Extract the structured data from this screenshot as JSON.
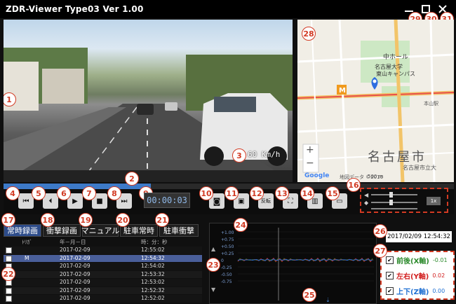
{
  "window": {
    "title": "ZDR-Viewer Type03 Ver 1.00",
    "controls": [
      {
        "badge": "29",
        "icon": "minimize-icon"
      },
      {
        "badge": "30",
        "icon": "maximize-icon"
      },
      {
        "badge": "31",
        "icon": "close-icon"
      }
    ]
  },
  "video": {
    "badge": "1",
    "speed_badge": "3",
    "speed_text": "60 Km/h"
  },
  "map": {
    "badge": "28",
    "labels": {
      "hall": "中ホール",
      "university": "名古屋大学",
      "campus": "東山キャンパス",
      "city": "名古屋市",
      "station": "本山駅",
      "building": "名古屋市立大",
      "google": "Google",
      "scale": "500 m",
      "credit": "地図データ ©2016"
    },
    "zoom_in": "+",
    "zoom_out": "−"
  },
  "seek": {
    "badge": "2"
  },
  "controls": {
    "buttons": [
      {
        "badge": "4",
        "icon": "skip-back-icon",
        "glyph": "⏮"
      },
      {
        "badge": "5",
        "icon": "step-back-icon",
        "glyph": "⏴"
      },
      {
        "badge": "6",
        "icon": "play-icon",
        "glyph": "▶"
      },
      {
        "badge": "7",
        "icon": "stop-icon",
        "glyph": "■"
      },
      {
        "badge": "8",
        "icon": "skip-forward-icon",
        "glyph": "⏭"
      }
    ],
    "time_badge": "9",
    "time": "00:00:03",
    "tools": [
      {
        "badge": "10",
        "icon": "camera-icon",
        "glyph": "📷"
      },
      {
        "badge": "11",
        "icon": "snapshot-icon",
        "glyph": "▣"
      },
      {
        "badge": "12",
        "icon": "rotate-icon",
        "glyph": "反転"
      },
      {
        "badge": "13",
        "icon": "fullscreen-icon",
        "glyph": "⛶"
      },
      {
        "badge": "14",
        "icon": "delete-icon",
        "glyph": "▥"
      },
      {
        "badge": "15",
        "icon": "folder-icon",
        "glyph": "▭"
      }
    ],
    "volume_badge": "16",
    "speed_button": "1x"
  },
  "tabs": [
    {
      "badge": "17",
      "label": "常時録画"
    },
    {
      "badge": "18",
      "label": "衝撃録画"
    },
    {
      "badge": "19",
      "label": "マニュアル"
    },
    {
      "badge": "20",
      "label": "駐車常時"
    },
    {
      "badge": "21",
      "label": "駐車衝撃"
    }
  ],
  "list": {
    "badge": "22",
    "headers": {
      "protect": "ﾄﾘｶﾞ",
      "date": "年－月－日",
      "time": "時：分：秒"
    },
    "rows": [
      {
        "date": "2017-02-09",
        "time": "12:55:02",
        "mark": "",
        "selected": false
      },
      {
        "date": "2017-02-09",
        "time": "12:54:32",
        "mark": "M",
        "selected": true
      },
      {
        "date": "2017-02-09",
        "time": "12:54:02",
        "mark": "",
        "selected": false
      },
      {
        "date": "2017-02-09",
        "time": "12:53:32",
        "mark": "",
        "selected": false
      },
      {
        "date": "2017-02-09",
        "time": "12:53:02",
        "mark": "",
        "selected": false
      },
      {
        "date": "2017-02-09",
        "time": "12:52:32",
        "mark": "",
        "selected": false
      },
      {
        "date": "2017-02-09",
        "time": "12:52:02",
        "mark": "",
        "selected": false
      }
    ]
  },
  "graph": {
    "scroll_badge": "23",
    "badge": "24",
    "bottom_badge": "25",
    "yticks": [
      "+1.00",
      "+0.75",
      "+0.50",
      "+0.25",
      "0",
      "-0.25",
      "-0.50",
      "-0.75"
    ]
  },
  "datetime": {
    "badge": "26",
    "value": "2017/02/09 12:54:32"
  },
  "axes": {
    "badge": "27",
    "items": [
      {
        "label": "前後(X軸)",
        "value": "-0.01",
        "color": "#2e8b2e",
        "valcolor": "#2e8b2e"
      },
      {
        "label": "左右(Y軸)",
        "value": "0.02",
        "color": "#d21f1f",
        "valcolor": "#d21f1f"
      },
      {
        "label": "上下(Z軸)",
        "value": "0.00",
        "color": "#1e6fd2",
        "valcolor": "#1e6fd2"
      }
    ]
  }
}
